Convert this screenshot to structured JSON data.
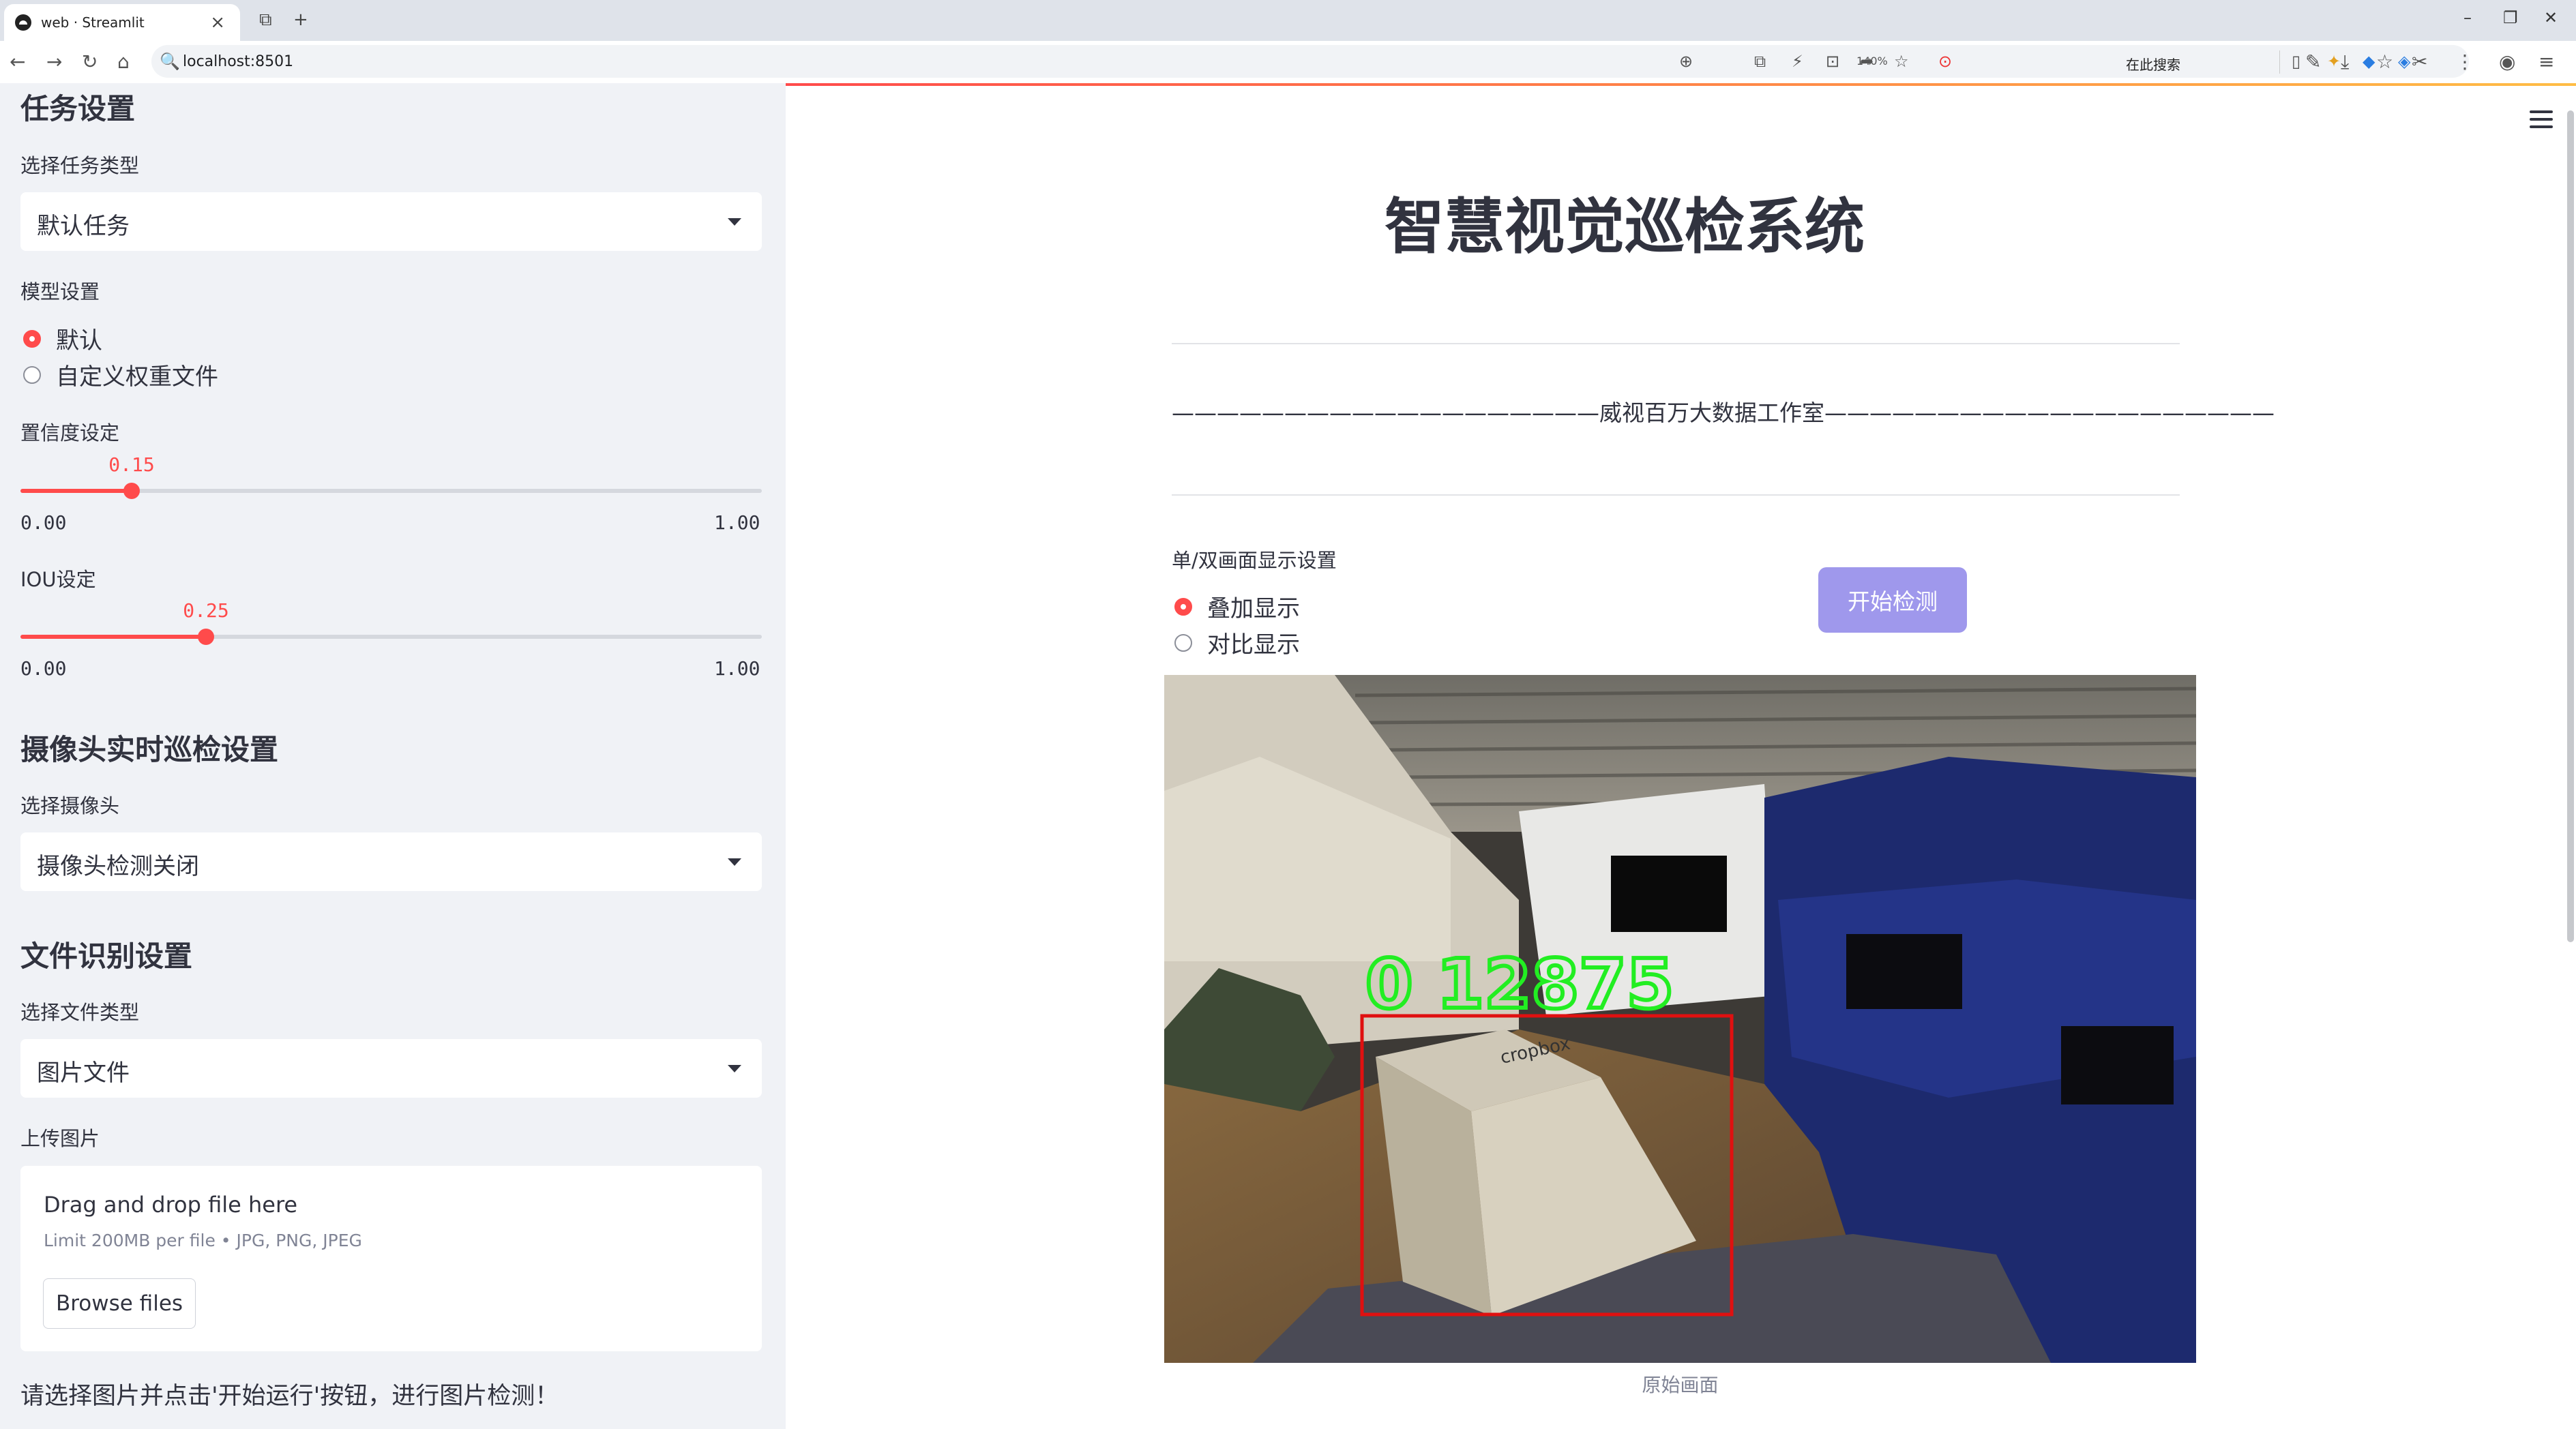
{
  "browser": {
    "tab_title": "web · Streamlit",
    "url": "localhost:8501",
    "zoom": "140%",
    "search_text": "在此搜索"
  },
  "sidebar": {
    "task_section": {
      "heading": "任务设置",
      "task_type_label": "选择任务类型",
      "task_type_value": "默认任务"
    },
    "model": {
      "label": "模型设置",
      "options": [
        "默认",
        "自定义权重文件"
      ],
      "selected": 0
    },
    "confidence": {
      "label": "置信度设定",
      "value": 0.15,
      "value_text": "0.15",
      "min_text": "0.00",
      "max_text": "1.00"
    },
    "iou": {
      "label": "IOU设定",
      "value": 0.25,
      "value_text": "0.25",
      "min_text": "0.00",
      "max_text": "1.00"
    },
    "camera_section": {
      "heading": "摄像头实时巡检设置",
      "label": "选择摄像头",
      "value": "摄像头检测关闭"
    },
    "file_section": {
      "heading": "文件识别设置",
      "file_type_label": "选择文件类型",
      "file_type_value": "图片文件",
      "upload_label": "上传图片",
      "drop_text": "Drag and drop file here",
      "limit_text": "Limit 200MB per file • JPG, PNG, JPEG",
      "browse_label": "Browse files"
    },
    "note": "请选择图片并点击'开始运行'按钮，进行图片检测！"
  },
  "main": {
    "title": "智慧视觉巡检系统",
    "subtitle": "———————————————————威视百万大数据工作室————————————————————",
    "display_label": "单/双画面显示设置",
    "display_options": [
      "叠加显示",
      "对比显示"
    ],
    "display_selected": 0,
    "start_button": "开始检测",
    "detection_label": "0  12875",
    "image_caption": "原始画面"
  },
  "colors": {
    "accent": "#ff4b4b",
    "button": "#9f98ec",
    "sidebar_bg": "#f0f2f6",
    "detect_box": "#e01010",
    "detect_text": "#22ee22"
  }
}
